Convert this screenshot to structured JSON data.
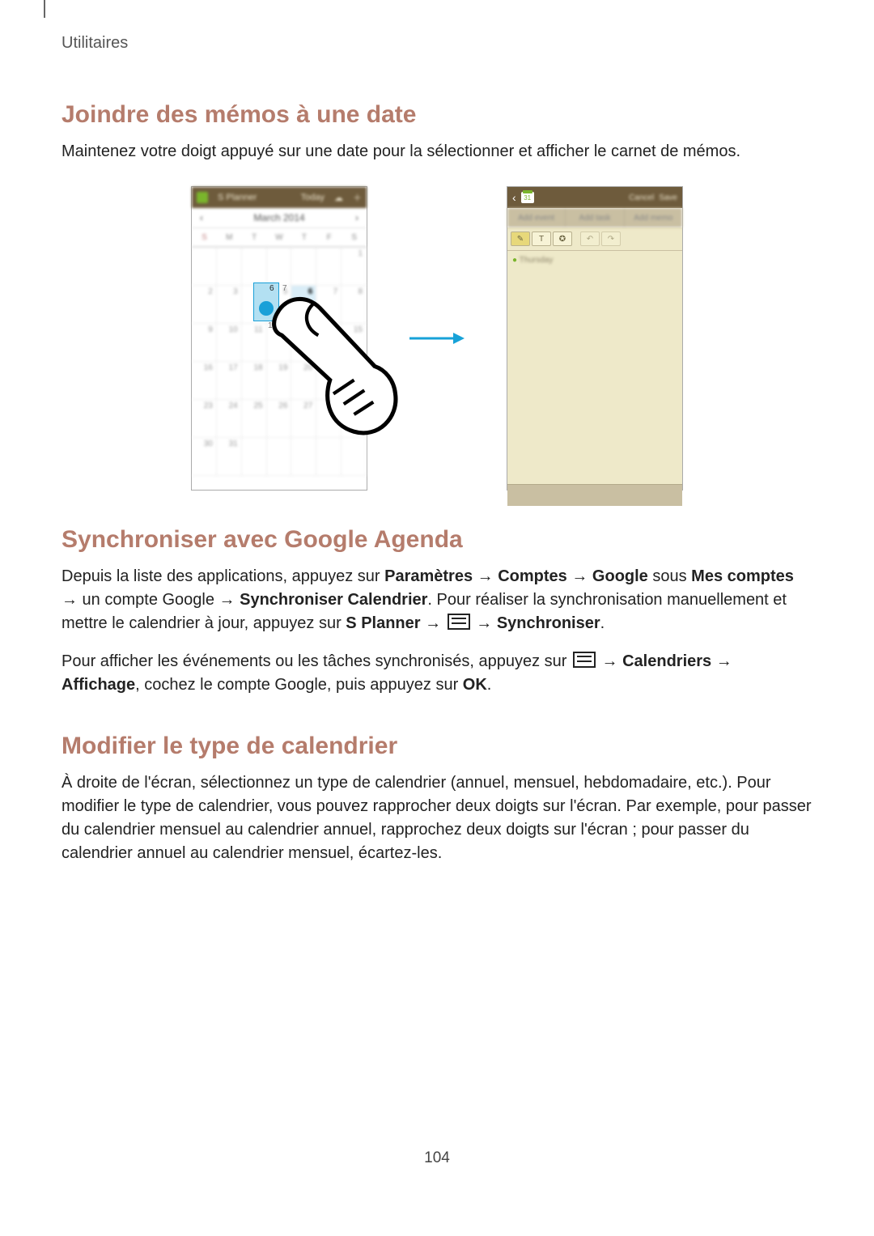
{
  "section_label": "Utilitaires",
  "h1": "Joindre des mémos à une date",
  "p1": "Maintenez votre doigt appuyé sur une date pour la sélectionner et afficher le carnet de mémos.",
  "illustration": {
    "left_device": {
      "app_title_hint": "S Planner",
      "today_hint": "Today",
      "month_hint": "March 2014",
      "overlay": {
        "day_selected": "6",
        "day_right": "7",
        "day_below": "13"
      }
    },
    "right_device": {
      "back_day": "31",
      "top_cancel": "Cancel",
      "top_save": "Save",
      "tabs": [
        "Add event",
        "Add task",
        "Add memo"
      ],
      "toolbar": {
        "pen": "✎",
        "text": "T",
        "bomb": "✪",
        "undo": "↶",
        "redo": "↷"
      },
      "memo_hint": "Thursday"
    }
  },
  "h2": "Synchroniser avec Google Agenda",
  "p2_pre": "Depuis la liste des applications, appuyez sur ",
  "p2_b1": "Paramètres",
  "p2_arrow": " → ",
  "p2_b2": "Comptes",
  "p2_b3": "Google",
  "p2_mid1": " sous ",
  "p2_b4": "Mes comptes",
  "p2_mid2": " → un compte Google → ",
  "p2_b5": "Synchroniser Calendrier",
  "p2_mid3": ". Pour réaliser la synchronisation manuellement et mettre le calendrier à jour, appuyez sur ",
  "p2_b6": "S Planner",
  "p2_mid4": " → ",
  "p2_b7": "Synchroniser",
  "p2_end": ".",
  "p3_pre": "Pour afficher les événements ou les tâches synchronisés, appuyez sur ",
  "p3_b1": "Calendriers",
  "p3_b2": "Affichage",
  "p3_mid": ", cochez le compte Google, puis appuyez sur ",
  "p3_b3": "OK",
  "h3": "Modifier le type de calendrier",
  "p4": "À droite de l'écran, sélectionnez un type de calendrier (annuel, mensuel, hebdomadaire, etc.). Pour modifier le type de calendrier, vous pouvez rapprocher deux doigts sur l'écran. Par exemple, pour passer du calendrier mensuel au calendrier annuel, rapprochez deux doigts sur l'écran ; pour passer du calendrier annuel au calendrier mensuel, écartez-les.",
  "page_number": "104"
}
